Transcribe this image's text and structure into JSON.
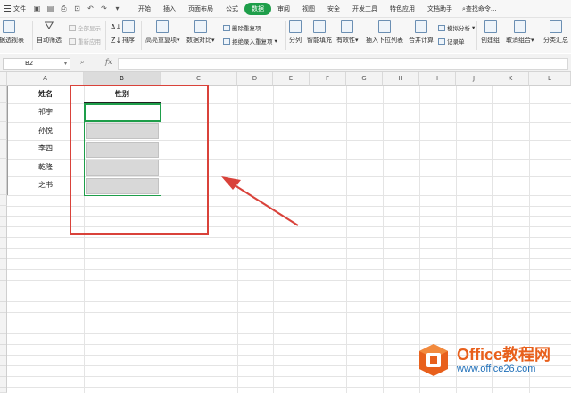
{
  "menubar": {
    "file": "文件",
    "tabs": [
      {
        "label": "开始",
        "active": false
      },
      {
        "label": "插入",
        "active": false
      },
      {
        "label": "页面布局",
        "active": false
      },
      {
        "label": "公式",
        "active": false
      },
      {
        "label": "数据",
        "active": true
      },
      {
        "label": "审阅",
        "active": false
      },
      {
        "label": "视图",
        "active": false
      },
      {
        "label": "安全",
        "active": false
      },
      {
        "label": "开发工具",
        "active": false
      },
      {
        "label": "特色应用",
        "active": false
      },
      {
        "label": "文档助手",
        "active": false
      }
    ],
    "search": "查找命令..."
  },
  "ribbon": {
    "pivot": "数据透视表",
    "autofilter": "自动筛选",
    "show_all": "全部显示",
    "reapply": "重新应用",
    "sort": "排序",
    "highlight_dup": "高亮重复项",
    "compare": "数据对比",
    "remove_dup": "删除重复项",
    "reject_dup": "拒绝录入重复项",
    "split": "分列",
    "fill": "智能填充",
    "validity": "有效性",
    "dropdown": "插入下拉列表",
    "consolidate": "合并计算",
    "simulate": "模拟分析",
    "record": "记录单",
    "group": "创建组",
    "ungroup": "取消组合",
    "subtotal": "分类汇总"
  },
  "formula_bar": {
    "cell_ref": "B2",
    "fx": "fx",
    "value": ""
  },
  "sheet": {
    "columns": [
      "A",
      "B",
      "C",
      "D",
      "E",
      "F",
      "G",
      "H",
      "I",
      "J",
      "K",
      "L"
    ],
    "selected_column": "B",
    "header_row": {
      "a": "姓名",
      "b": "性别"
    },
    "names": [
      "祁宇",
      "孙悦",
      "李四",
      "乾隆",
      "之书"
    ],
    "genders": [
      "",
      "",
      "",
      "",
      ""
    ]
  },
  "watermark": {
    "title": "Office教程网",
    "url": "www.office26.com"
  },
  "colors": {
    "accent_green": "#1e9e4a",
    "annotation_red": "#d9423a",
    "watermark_orange": "#e8601c",
    "watermark_blue": "#1f6fb8"
  }
}
